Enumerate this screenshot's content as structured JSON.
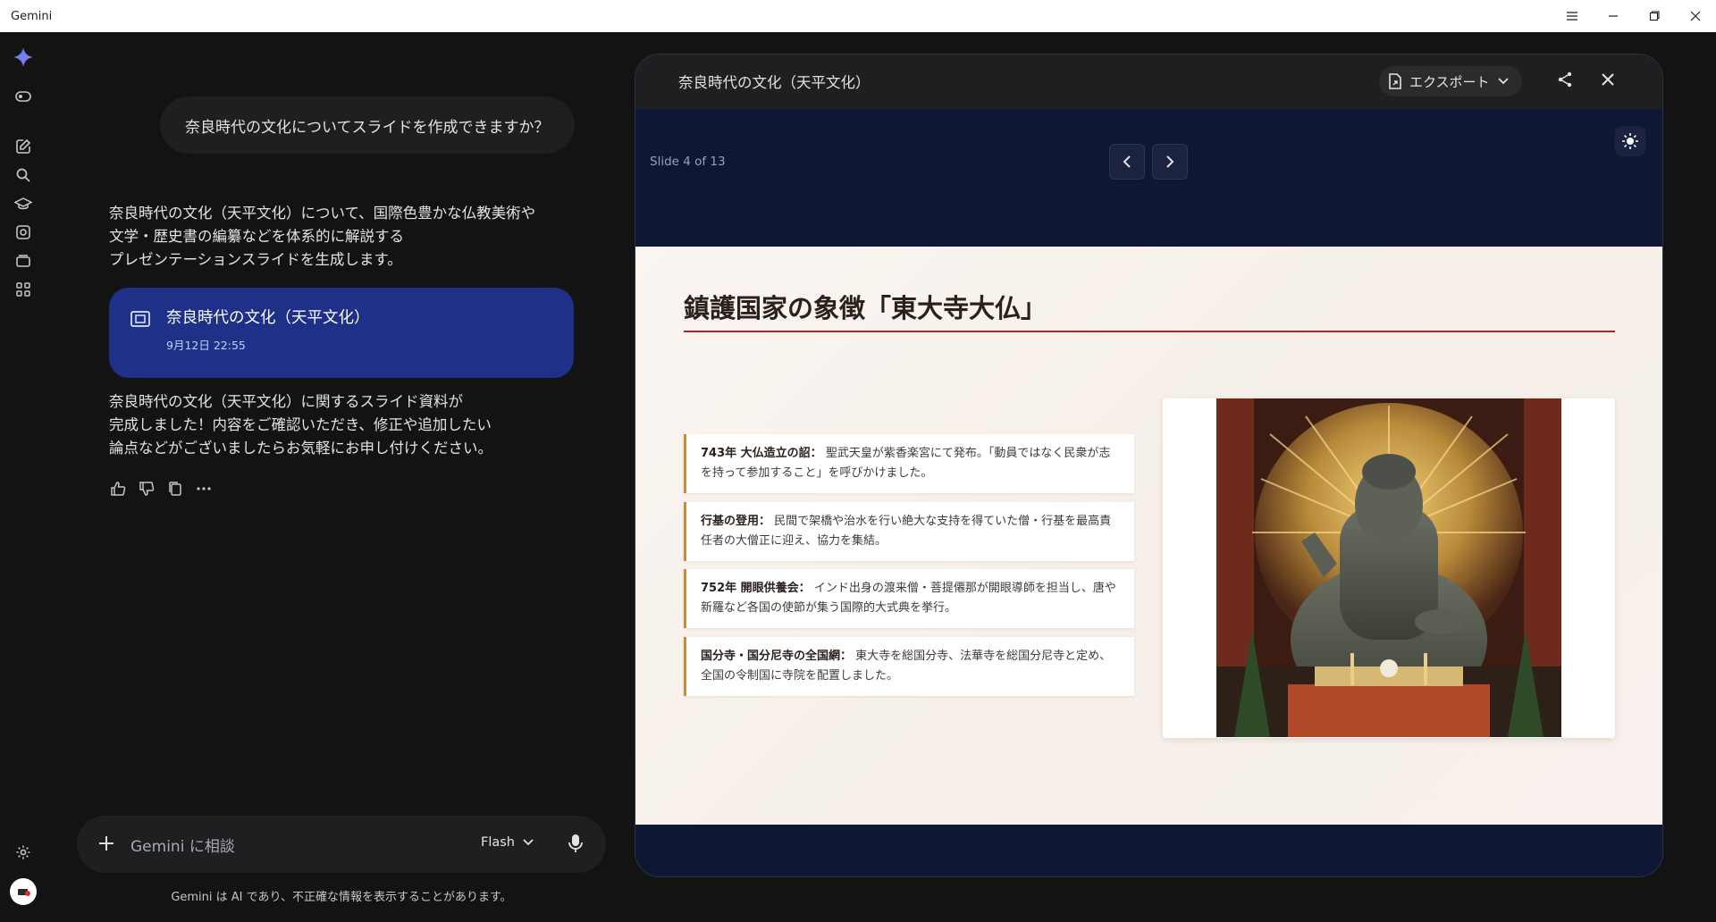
{
  "window": {
    "title": "Gemini"
  },
  "chat": {
    "user_prompt": "奈良時代の文化についてスライドを作成できますか？",
    "intro_message": "奈良時代の文化（天平文化）について、国際色豊かな仏教美術や\n文学・歴史書の編纂などを体系的に解説する\nプレゼンテーションスライドを生成します。",
    "artifact": {
      "title": "奈良時代の文化（天平文化）",
      "date": "9月12日 22:55"
    },
    "completion_message": "奈良時代の文化（天平文化）に関するスライド資料が\n完成しました！内容をご確認いただき、修正や追加したい\n論点などがございましたらお気軽にお申し付けください。"
  },
  "input": {
    "placeholder": "Gemini に相談",
    "model": "Flash"
  },
  "disclaimer": "Gemini は AI であり、不正確な情報を表示することがあります。",
  "panel": {
    "title": "奈良時代の文化（天平文化）",
    "export_label": "エクスポート",
    "slide_counter": "Slide 4 of 13"
  },
  "slide": {
    "title": "鎮護国家の象徴「東大寺大仏」",
    "bullets": [
      {
        "term": "743年 大仏造立の詔：",
        "text": "聖武天皇が紫香楽宮にて発布。「動員ではなく民衆が志を持って参加すること」を呼びかけました。"
      },
      {
        "term": "行基の登用：",
        "text": "民間で架橋や治水を行い絶大な支持を得ていた僧・行基を最高責任者の大僧正に迎え、協力を集結。"
      },
      {
        "term": "752年 開眼供養会：",
        "text": "インド出身の渡来僧・菩提僊那が開眼導師を担当し、唐や新羅など各国の使節が集う国際的大式典を挙行。"
      },
      {
        "term": "国分寺・国分尼寺の全国網：",
        "text": "東大寺を総国分寺、法華寺を総国分尼寺と定め、全国の令制国に寺院を配置しました。"
      }
    ]
  },
  "colors": {
    "accent_blue": "#1f3088",
    "slide_rule": "#a42a24",
    "bullet_border": "#c98a3a"
  }
}
